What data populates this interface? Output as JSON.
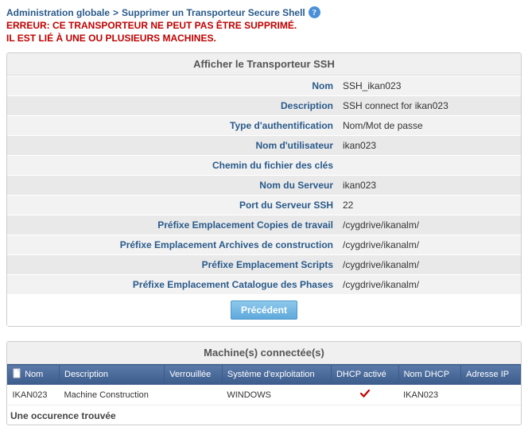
{
  "breadcrumb": {
    "section": "Administration globale",
    "sep": ">",
    "page": "Supprimer un Transporteur Secure Shell"
  },
  "error": {
    "line1": "ERREUR: CE TRANSPORTEUR NE PEUT PAS ÊTRE SUPPRIMÉ.",
    "line2": "IL EST LIÉ À UNE OU PLUSIEURS MACHINES."
  },
  "panel1": {
    "title": "Afficher le Transporteur SSH",
    "fields": [
      {
        "label": "Nom",
        "value": "SSH_ikan023"
      },
      {
        "label": "Description",
        "value": "SSH connect for ikan023"
      },
      {
        "label": "Type d'authentification",
        "value": "Nom/Mot de passe"
      },
      {
        "label": "Nom d'utilisateur",
        "value": "ikan023"
      },
      {
        "label": "Chemin du fichier des clés",
        "value": ""
      },
      {
        "label": "Nom du Serveur",
        "value": "ikan023"
      },
      {
        "label": "Port du Serveur SSH",
        "value": "22"
      },
      {
        "label": "Préfixe Emplacement Copies de travail",
        "value": "/cygdrive/ikanalm/"
      },
      {
        "label": "Préfixe Emplacement Archives de construction",
        "value": "/cygdrive/ikanalm/"
      },
      {
        "label": "Préfixe Emplacement Scripts",
        "value": "/cygdrive/ikanalm/"
      },
      {
        "label": "Préfixe Emplacement Catalogue des Phases",
        "value": "/cygdrive/ikanalm/"
      }
    ],
    "button": "Précédent"
  },
  "panel2": {
    "title": "Machine(s) connectée(s)",
    "headers": {
      "name": "Nom",
      "desc": "Description",
      "locked": "Verrouillée",
      "os": "Système d'exploitation",
      "dhcp": "DHCP activé",
      "dhcpname": "Nom DHCP",
      "ip": "Adresse IP"
    },
    "rows": [
      {
        "name": "IKAN023",
        "desc": "Machine Construction",
        "locked": "",
        "os": "WINDOWS",
        "dhcp": true,
        "dhcpname": "IKAN023",
        "ip": ""
      }
    ],
    "status": "Une occurence trouvée"
  }
}
